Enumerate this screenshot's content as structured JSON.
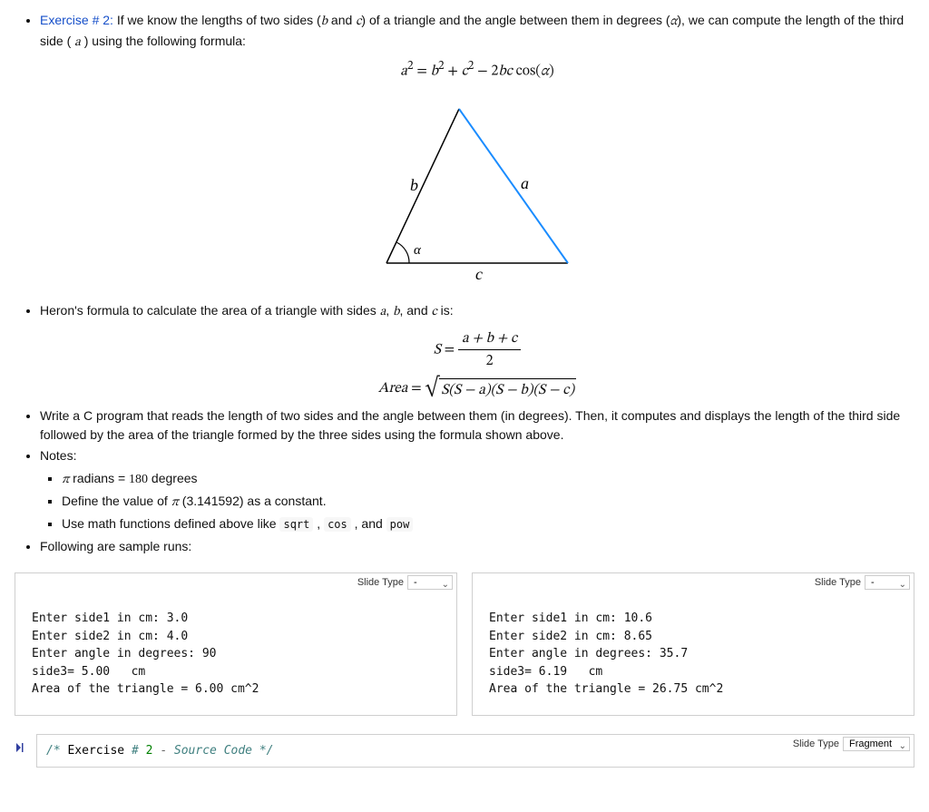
{
  "exercise": {
    "title_prefix": "Exercise # 2:",
    "title_rest": " If we know the lengths of two sides (",
    "var_b": "b",
    "and1": " and ",
    "var_c": "c",
    "rest1": ") of a triangle and the angle between them in degrees (",
    "var_alpha": "α",
    "rest2": "), we can compute the length of the third side ( ",
    "var_a": "a",
    "rest3": " ) using the following formula:"
  },
  "formula1": {
    "lhs": "a",
    "sup1": "2",
    "eq": " = ",
    "t1": "b",
    "sup2": "2",
    "plus": " + ",
    "t2": "c",
    "sup3": "2",
    "minus": " − 2",
    "bc": "bc",
    "cos": " cos(",
    "alpha": "α",
    "close": ")"
  },
  "heron_intro": "Heron's formula to calculate the area of a triangle with sides ",
  "heron_vars": {
    "a": "a",
    "c1": ", ",
    "b": "b",
    "c2": ", and ",
    "c": "c",
    "c3": " is:"
  },
  "formula_s": {
    "S": "S",
    "eq": " = ",
    "num": "a + b + c",
    "den": "2"
  },
  "formula_area": {
    "area": "Area",
    "eq": " = ",
    "body": "S(S − a)(S − b)(S − c)"
  },
  "task": "Write a C program that reads the length of two sides and the angle between them (in degrees). Then, it computes and displays the length of the third side followed by the area of the triangle formed by the three sides using the formula shown above.",
  "notes_label": "Notes:",
  "notes": {
    "n1a": "π",
    "n1b": " radians = ",
    "n1c": "180",
    "n1d": " degrees",
    "n2a": "Define the value of ",
    "n2b": "π",
    "n2c": " (3.141592) as a constant.",
    "n3a": "Use math functions defined above like ",
    "sqrt": "sqrt",
    "comma1": " , ",
    "cos": "cos",
    "comma2": " , and ",
    "pow": "pow"
  },
  "following": "Following are sample runs:",
  "slide_label": "Slide Type",
  "slide_value_dash": "-",
  "slide_value_fragment": "Fragment",
  "run1": "Enter side1 in cm: 3.0\nEnter side2 in cm: 4.0\nEnter angle in degrees: 90\nside3= 5.00   cm\nArea of the triangle = 6.00 cm^2",
  "run2": "Enter side1 in cm: 10.6\nEnter side2 in cm: 8.65\nEnter angle in degrees: 35.7\nside3= 6.19   cm\nArea of the triangle = 26.75 cm^2",
  "code_gutter": "▸|",
  "code_comment": {
    "open": "/* ",
    "ex": "Exercise ",
    "hash": "# ",
    "num": "2 ",
    "dash": "- ",
    "rest": "Source Code */"
  },
  "diagram_labels": {
    "a": "a",
    "b": "b",
    "c": "c",
    "alpha": "α"
  }
}
